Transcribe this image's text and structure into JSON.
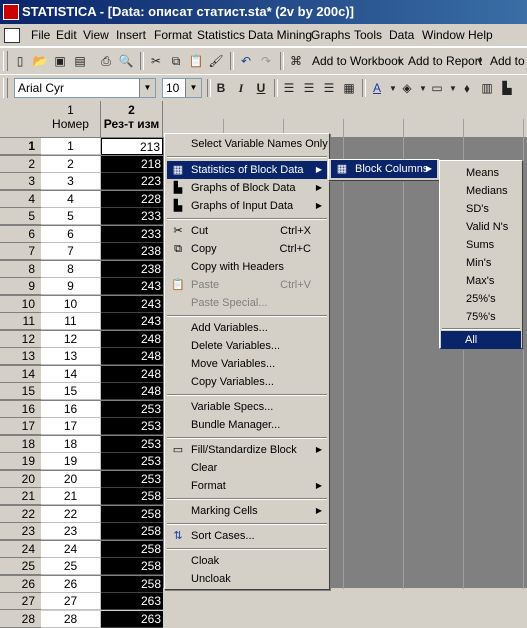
{
  "window": {
    "title": "STATISTICA - [Data: описат статист.sta* (2v by 200c)]"
  },
  "menubar": [
    "File",
    "Edit",
    "View",
    "Insert",
    "Format",
    "Statistics",
    "Data Mining",
    "Graphs",
    "Tools",
    "Data",
    "Window",
    "Help"
  ],
  "toolbar1": {
    "add_workbook": "Add to Workbook",
    "add_report": "Add to Report",
    "add_ms": "Add to M"
  },
  "toolbar2": {
    "font": "Arial Cyr",
    "size": "10",
    "bold": "B",
    "italic": "I",
    "underline": "U"
  },
  "sheet": {
    "col1_num": "1",
    "col1_name": "Номер",
    "col2_num": "2",
    "col2_name": "Рез-т изм",
    "rows": [
      {
        "r": "1",
        "n": "1",
        "v": "213"
      },
      {
        "r": "2",
        "n": "2",
        "v": "218"
      },
      {
        "r": "3",
        "n": "3",
        "v": "223"
      },
      {
        "r": "4",
        "n": "4",
        "v": "228"
      },
      {
        "r": "5",
        "n": "5",
        "v": "233"
      },
      {
        "r": "6",
        "n": "6",
        "v": "233"
      },
      {
        "r": "7",
        "n": "7",
        "v": "238"
      },
      {
        "r": "8",
        "n": "8",
        "v": "238"
      },
      {
        "r": "9",
        "n": "9",
        "v": "243"
      },
      {
        "r": "10",
        "n": "10",
        "v": "243"
      },
      {
        "r": "11",
        "n": "11",
        "v": "243"
      },
      {
        "r": "12",
        "n": "12",
        "v": "248"
      },
      {
        "r": "13",
        "n": "13",
        "v": "248"
      },
      {
        "r": "14",
        "n": "14",
        "v": "248"
      },
      {
        "r": "15",
        "n": "15",
        "v": "248"
      },
      {
        "r": "16",
        "n": "16",
        "v": "253"
      },
      {
        "r": "17",
        "n": "17",
        "v": "253"
      },
      {
        "r": "18",
        "n": "18",
        "v": "253"
      },
      {
        "r": "19",
        "n": "19",
        "v": "253"
      },
      {
        "r": "20",
        "n": "20",
        "v": "253"
      },
      {
        "r": "21",
        "n": "21",
        "v": "258"
      },
      {
        "r": "22",
        "n": "22",
        "v": "258"
      },
      {
        "r": "23",
        "n": "23",
        "v": "258"
      },
      {
        "r": "24",
        "n": "24",
        "v": "258"
      },
      {
        "r": "25",
        "n": "25",
        "v": "258"
      },
      {
        "r": "26",
        "n": "26",
        "v": "258"
      },
      {
        "r": "27",
        "n": "27",
        "v": "263"
      },
      {
        "r": "28",
        "n": "28",
        "v": "263"
      }
    ]
  },
  "context_menu": {
    "select_names": "Select Variable Names Only",
    "stats_block": "Statistics of Block Data",
    "graphs_block": "Graphs of Block Data",
    "graphs_input": "Graphs of Input Data",
    "cut": "Cut",
    "cut_sc": "Ctrl+X",
    "copy": "Copy",
    "copy_sc": "Ctrl+C",
    "copy_headers": "Copy with Headers",
    "paste": "Paste",
    "paste_sc": "Ctrl+V",
    "paste_special": "Paste Special...",
    "add_vars": "Add Variables...",
    "delete_vars": "Delete Variables...",
    "move_vars": "Move Variables...",
    "copy_vars": "Copy Variables...",
    "var_specs": "Variable Specs...",
    "bundle_mgr": "Bundle Manager...",
    "fill_std": "Fill/Standardize Block",
    "clear": "Clear",
    "format": "Format",
    "marking": "Marking Cells",
    "sort": "Sort Cases...",
    "cloak": "Cloak",
    "uncloak": "Uncloak"
  },
  "submenu1": {
    "block_columns": "Block Columns"
  },
  "submenu2": [
    "Means",
    "Medians",
    "SD's",
    "Valid N's",
    "Sums",
    "Min's",
    "Max's",
    "25%'s",
    "75%'s",
    "All"
  ]
}
